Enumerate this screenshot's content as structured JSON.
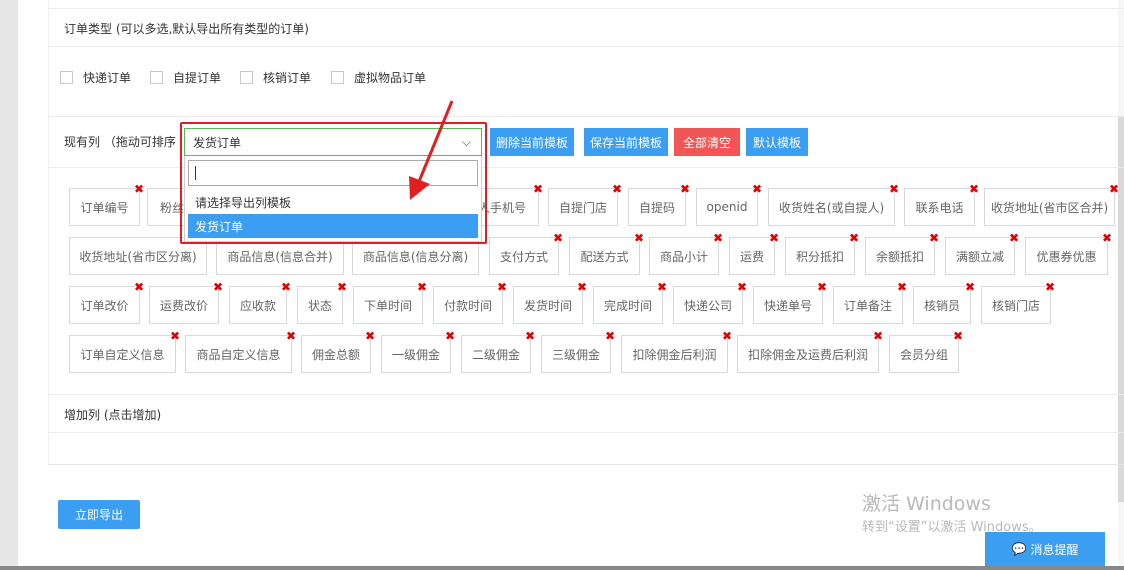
{
  "order_type": {
    "label": "订单类型 (可以多选,默认导出所有类型的订单)",
    "options": [
      "快递订单",
      "自提订单",
      "核销订单",
      "虚拟物品订单"
    ]
  },
  "columns": {
    "label": "现有列 （拖动可排序",
    "template_select": {
      "selected": "发货订单",
      "search_value": "",
      "options": [
        "请选择导出列模板",
        "发货订单"
      ],
      "active_option": "发货订单"
    },
    "buttons": {
      "delete_template": "删除当前模板",
      "save_template": "保存当前模板",
      "clear_all": "全部清空",
      "default_template": "默认模板"
    },
    "chips": [
      "订单编号",
      "粉丝",
      "收货人手机号",
      "自提门店",
      "自提码",
      "openid",
      "收货姓名(或自提人)",
      "联系电话",
      "收货地址(省市区合并)",
      "收货地址(省市区分离)",
      "商品信息(信息合并)",
      "商品信息(信息分离)",
      "支付方式",
      "配送方式",
      "商品小计",
      "运费",
      "积分抵扣",
      "余额抵扣",
      "满额立减",
      "优惠券优惠",
      "订单改价",
      "运费改价",
      "应收款",
      "状态",
      "下单时间",
      "付款时间",
      "发货时间",
      "完成时间",
      "快递公司",
      "快递单号",
      "订单备注",
      "核销员",
      "核销门店",
      "订单自定义信息",
      "商品自定义信息",
      "佣金总额",
      "一级佣金",
      "二级佣金",
      "三级佣金",
      "扣除佣金后利润",
      "扣除佣金及运费后利润",
      "会员分组"
    ]
  },
  "add_columns": {
    "label": "增加列 (点击增加)"
  },
  "export_button": "立即导出",
  "watermark": {
    "line1": "激活 Windows",
    "line2": "转到“设置”以激活 Windows。"
  },
  "message_button": "消息提醒",
  "colors": {
    "accent": "#3c9ef0",
    "danger": "#f05656",
    "highlight_border": "#e02020"
  }
}
